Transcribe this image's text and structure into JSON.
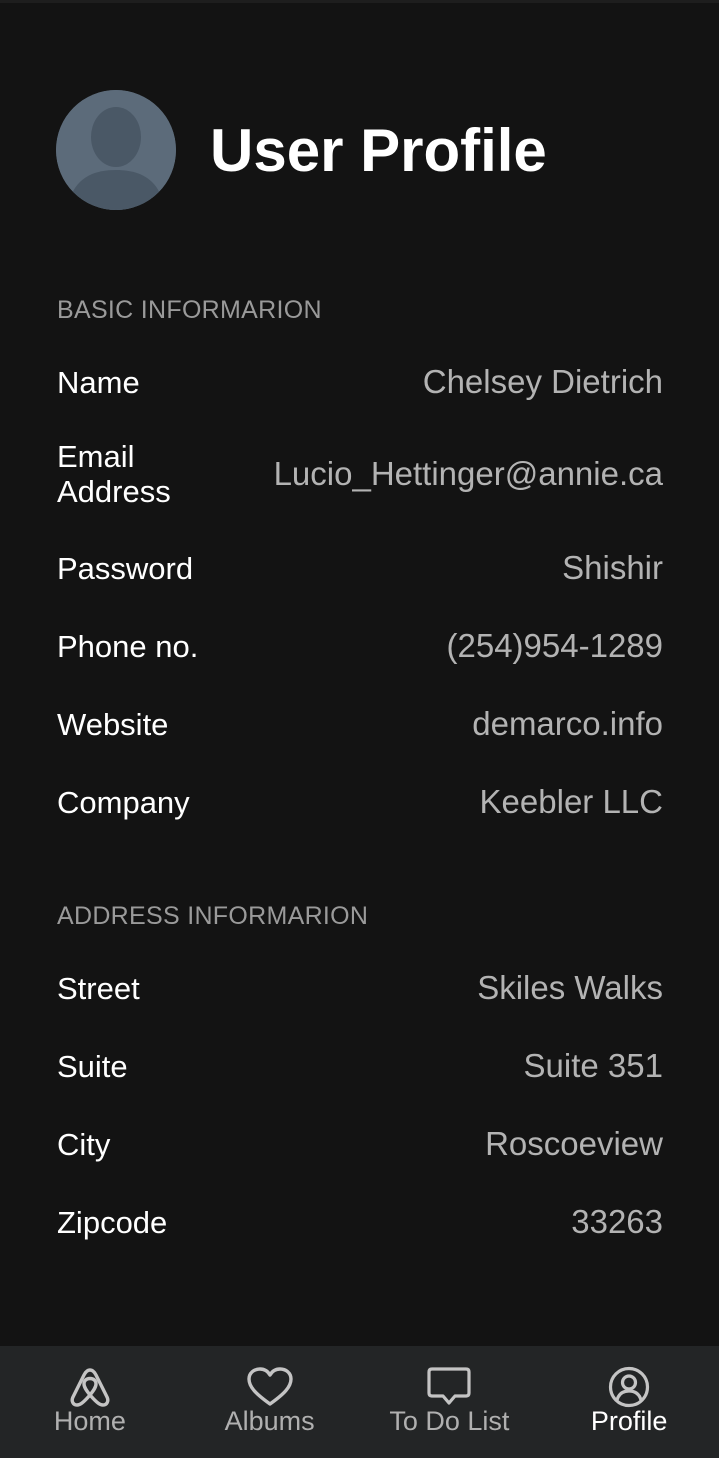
{
  "header": {
    "title": "User Profile",
    "avatar_icon": "person-avatar-icon"
  },
  "basic": {
    "section_label": "BASIC INFORMARION",
    "rows": [
      {
        "label": "Name",
        "value": "Chelsey Dietrich"
      },
      {
        "label": "Email Address",
        "value": "Lucio_Hettinger@annie.ca"
      },
      {
        "label": "Password",
        "value": "Shishir"
      },
      {
        "label": "Phone no.",
        "value": "(254)954-1289"
      },
      {
        "label": "Website",
        "value": "demarco.info"
      },
      {
        "label": "Company",
        "value": "Keebler LLC"
      }
    ]
  },
  "address": {
    "section_label": "ADDRESS INFORMARION",
    "rows": [
      {
        "label": "Street",
        "value": "Skiles Walks"
      },
      {
        "label": "Suite",
        "value": "Suite 351"
      },
      {
        "label": "City",
        "value": "Roscoeview"
      },
      {
        "label": "Zipcode",
        "value": "33263"
      }
    ]
  },
  "nav": {
    "items": [
      {
        "label": "Home",
        "icon": "airbnb-home-icon",
        "active": false
      },
      {
        "label": "Albums",
        "icon": "heart-icon",
        "active": false
      },
      {
        "label": "To Do List",
        "icon": "chat-bubble-icon",
        "active": false
      },
      {
        "label": "Profile",
        "icon": "user-circle-icon",
        "active": true
      }
    ]
  },
  "colors": {
    "background": "#131313",
    "nav_background": "#232526",
    "value_text": "#b3b3b3",
    "section_label": "#9a9a9a",
    "avatar": "#5c6b7a"
  }
}
